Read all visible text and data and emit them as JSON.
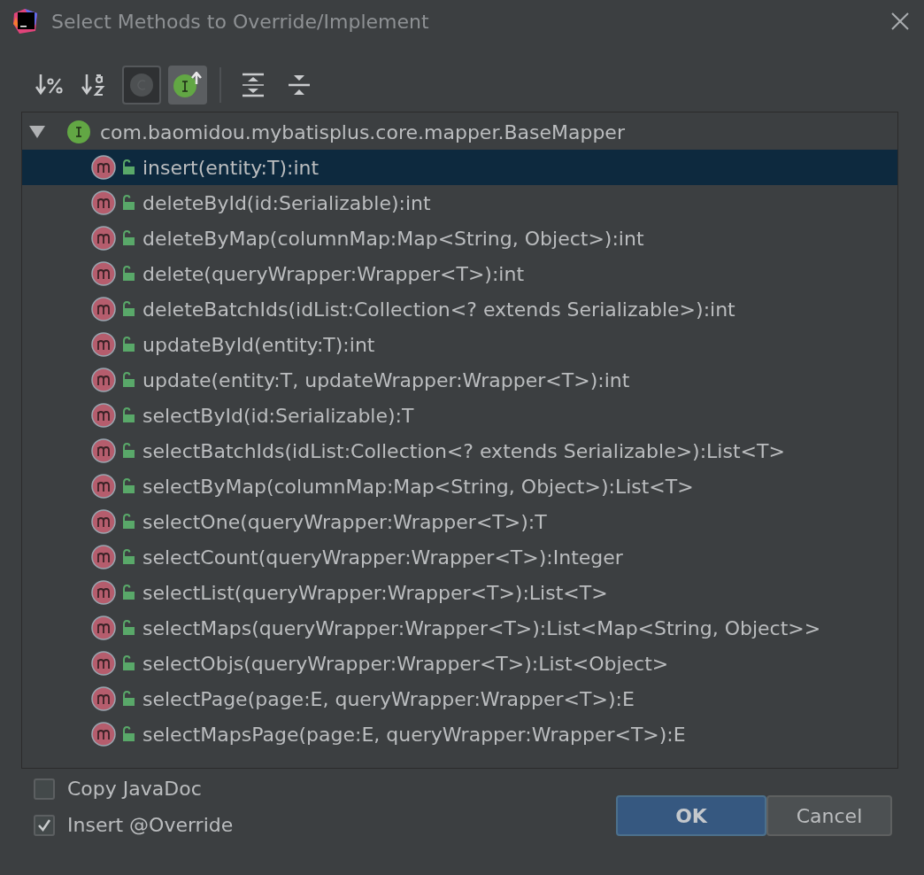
{
  "window": {
    "title": "Select Methods to Override/Implement"
  },
  "toolbar": [
    {
      "kind": "sort-percent",
      "on": false
    },
    {
      "kind": "sort-alpha",
      "on": false
    },
    {
      "kind": "show-classes",
      "on": false
    },
    {
      "kind": "show-interfaces",
      "on": true
    },
    {
      "kind": "expand-all",
      "on": false
    },
    {
      "kind": "collapse-all",
      "on": false
    }
  ],
  "tree": {
    "label": "com.baomidou.mybatisplus.core.mapper.BaseMapper",
    "expanded": true,
    "children": [
      {
        "label": "insert(entity:T):int",
        "selected": true
      },
      {
        "label": "deleteById(id:Serializable):int",
        "selected": false
      },
      {
        "label": "deleteByMap(columnMap:Map<String, Object>):int",
        "selected": false
      },
      {
        "label": "delete(queryWrapper:Wrapper<T>):int",
        "selected": false
      },
      {
        "label": "deleteBatchIds(idList:Collection<? extends Serializable>):int",
        "selected": false
      },
      {
        "label": "updateById(entity:T):int",
        "selected": false
      },
      {
        "label": "update(entity:T, updateWrapper:Wrapper<T>):int",
        "selected": false
      },
      {
        "label": "selectById(id:Serializable):T",
        "selected": false
      },
      {
        "label": "selectBatchIds(idList:Collection<? extends Serializable>):List<T>",
        "selected": false
      },
      {
        "label": "selectByMap(columnMap:Map<String, Object>):List<T>",
        "selected": false
      },
      {
        "label": "selectOne(queryWrapper:Wrapper<T>):T",
        "selected": false
      },
      {
        "label": "selectCount(queryWrapper:Wrapper<T>):Integer",
        "selected": false
      },
      {
        "label": "selectList(queryWrapper:Wrapper<T>):List<T>",
        "selected": false
      },
      {
        "label": "selectMaps(queryWrapper:Wrapper<T>):List<Map<String, Object>>",
        "selected": false
      },
      {
        "label": "selectObjs(queryWrapper:Wrapper<T>):List<Object>",
        "selected": false
      },
      {
        "label": "selectPage(page:E, queryWrapper:Wrapper<T>):E",
        "selected": false
      },
      {
        "label": "selectMapsPage(page:E, queryWrapper:Wrapper<T>):E",
        "selected": false
      }
    ]
  },
  "options": [
    {
      "label": "Copy JavaDoc",
      "checked": false
    },
    {
      "label": "Insert @Override",
      "checked": true
    }
  ],
  "buttons": [
    {
      "label": "OK",
      "kind": "primary"
    },
    {
      "label": "Cancel",
      "kind": "secondary"
    }
  ]
}
